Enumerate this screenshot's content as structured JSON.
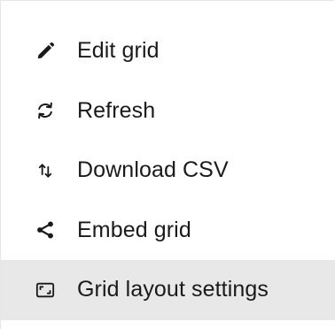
{
  "menu": {
    "items": [
      {
        "id": "edit-grid",
        "label": "Edit grid",
        "icon": "pencil-icon",
        "highlighted": false
      },
      {
        "id": "refresh",
        "label": "Refresh",
        "icon": "refresh-icon",
        "highlighted": false
      },
      {
        "id": "download-csv",
        "label": "Download CSV",
        "icon": "sort-arrows-icon",
        "highlighted": false
      },
      {
        "id": "embed-grid",
        "label": "Embed grid",
        "icon": "share-icon",
        "highlighted": false
      },
      {
        "id": "grid-layout-settings",
        "label": "Grid layout settings",
        "icon": "layout-frame-icon",
        "highlighted": true
      }
    ]
  },
  "colors": {
    "text": "#1a1a1a",
    "highlight": "#e8e8e8",
    "border": "#e6e6e6"
  }
}
